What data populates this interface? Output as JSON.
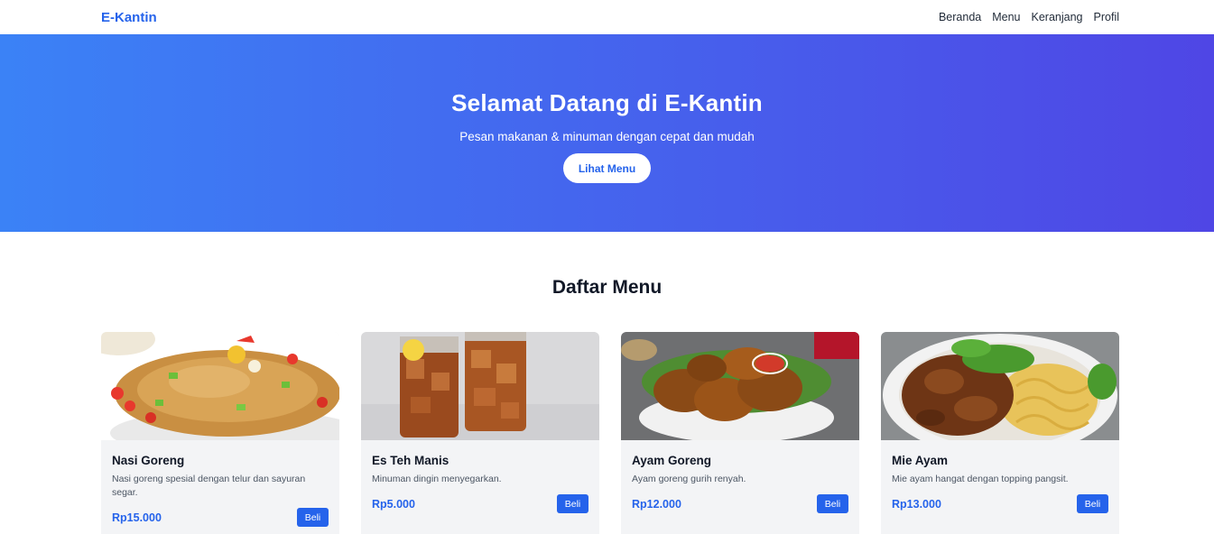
{
  "navbar": {
    "brand": "E-Kantin",
    "links": [
      "Beranda",
      "Menu",
      "Keranjang",
      "Profil"
    ]
  },
  "hero": {
    "title": "Selamat Datang di E-Kantin",
    "subtitle": "Pesan makanan & minuman dengan cepat dan mudah",
    "button_label": "Lihat Menu"
  },
  "menu": {
    "title": "Daftar Menu",
    "items": [
      {
        "name": "Nasi Goreng",
        "description": "Nasi goreng spesial dengan telur dan sayuran segar.",
        "price": "Rp15.000",
        "buy_label": "Beli",
        "image": "fried-rice-photo"
      },
      {
        "name": "Es Teh Manis",
        "description": "Minuman dingin menyegarkan.",
        "price": "Rp5.000",
        "buy_label": "Beli",
        "image": "iced-tea-photo"
      },
      {
        "name": "Ayam Goreng",
        "description": "Ayam goreng gurih renyah.",
        "price": "Rp12.000",
        "buy_label": "Beli",
        "image": "fried-chicken-photo"
      },
      {
        "name": "Mie Ayam",
        "description": "Mie ayam hangat dengan topping pangsit.",
        "price": "Rp13.000",
        "buy_label": "Beli",
        "image": "chicken-noodle-photo"
      }
    ]
  },
  "colors": {
    "accent": "#2563eb",
    "hero_gradient_start": "#3b82f6",
    "hero_gradient_end": "#4f46e5",
    "card_background": "#f3f4f6"
  }
}
